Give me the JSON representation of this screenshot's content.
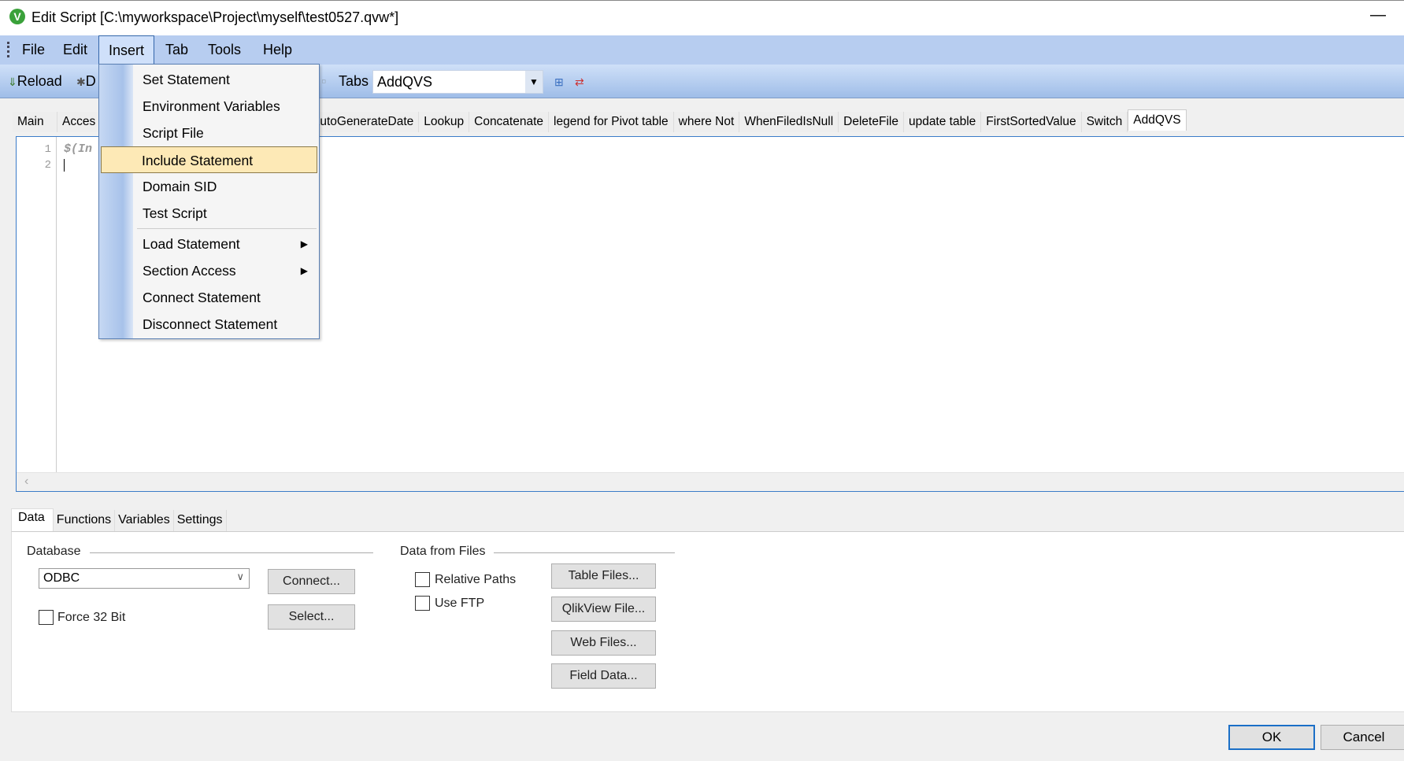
{
  "window": {
    "title": "Edit Script [C:\\myworkspace\\Project\\myself\\test0527.qvw*]",
    "app_icon": "V",
    "minimize": "—"
  },
  "menubar": {
    "items": [
      "File",
      "Edit",
      "Insert",
      "Tab",
      "Tools",
      "Help"
    ],
    "open": "Insert"
  },
  "toolbar": {
    "reload": "Reload",
    "debug": "D",
    "tabs_label": "Tabs",
    "tabs_value": "AddQVS"
  },
  "script_tabs": {
    "left": [
      "Main",
      "Acces"
    ],
    "right": [
      "AutoGenerateDate",
      "Lookup",
      "Concatenate",
      "legend for Pivot table",
      "where Not",
      "WhenFiledIsNull",
      "DeleteFile",
      "update table",
      "FirstSortedValue",
      "Switch",
      "AddQVS"
    ],
    "active": "AddQVS"
  },
  "editor": {
    "line_numbers": [
      "1",
      "2"
    ],
    "line1": "$(In"
  },
  "insert_menu": {
    "items": [
      {
        "label": "Set Statement"
      },
      {
        "label": "Environment Variables"
      },
      {
        "label": "Script File"
      },
      {
        "label": "Include Statement",
        "highlighted": true
      },
      {
        "label": "Domain SID"
      },
      {
        "label": "Test Script"
      },
      {
        "label": "Load Statement",
        "submenu": true
      },
      {
        "label": "Section Access",
        "submenu": true
      },
      {
        "label": "Connect Statement"
      },
      {
        "label": "Disconnect Statement"
      }
    ]
  },
  "bottom_tabs": {
    "items": [
      "Data",
      "Functions",
      "Variables",
      "Settings"
    ],
    "active": "Data"
  },
  "data_panel": {
    "database": {
      "title": "Database",
      "select_value": "ODBC",
      "connect": "Connect...",
      "select": "Select...",
      "force32": "Force 32 Bit",
      "force32_checked": false
    },
    "files": {
      "title": "Data from Files",
      "relative_paths": "Relative Paths",
      "relative_paths_checked": false,
      "use_ftp": "Use FTP",
      "use_ftp_checked": false,
      "buttons": [
        "Table Files...",
        "QlikView File...",
        "Web Files...",
        "Field Data..."
      ]
    }
  },
  "dialog": {
    "ok": "OK",
    "cancel": "Cancel"
  }
}
